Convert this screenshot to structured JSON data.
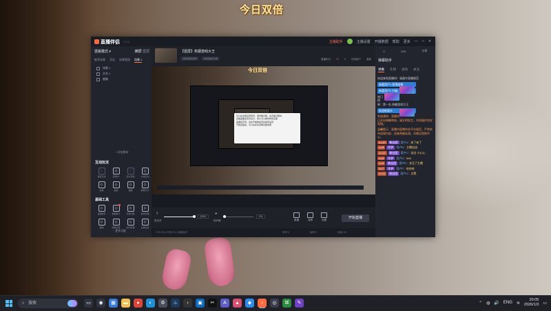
{
  "desktop": {
    "overlay_title": "今日双倍"
  },
  "app": {
    "name": "直播伴侣",
    "version": "7.0.0",
    "titlebar": {
      "items": [
        "主播设置",
        "开播数据",
        "帮助",
        "更多"
      ],
      "status": "主播助手"
    },
    "left": {
      "mode_label": "竖版模式",
      "mode_tabs": [
        "横屏",
        "竖屏"
      ],
      "source_tabs": [
        "推荐场景",
        "添加",
        "场景管理",
        "场景 1"
      ],
      "sources": [
        "场景 1",
        "文本 1",
        "摄像"
      ],
      "add_source_label": "+ 添加素材",
      "interact_title": "互动玩法",
      "interact_items": [
        {
          "label": "语音互动",
          "icon": "mic-icon",
          "dim": true
        },
        {
          "label": "连线PK",
          "icon": "pk-icon",
          "dim": false
        },
        {
          "label": "观众连线",
          "icon": "link-icon",
          "dim": true
        },
        {
          "label": "礼物互动",
          "icon": "gift-icon",
          "dim": false
        },
        {
          "label": "投票",
          "icon": "download-icon",
          "dim": false
        },
        {
          "label": "抽奖",
          "icon": "lottery-icon",
          "dim": false
        },
        {
          "label": "福袋",
          "icon": "bag-icon",
          "dim": false
        },
        {
          "label": "屏幕分享",
          "icon": "share-icon",
          "dim": false
        }
      ],
      "tools_title": "基础工具",
      "tools_items": [
        {
          "label": "直播助手",
          "icon": "assistant-icon",
          "badge": false
        },
        {
          "label": "数据统计",
          "icon": "chart-icon",
          "badge": true
        },
        {
          "label": "高级功能",
          "icon": "advanced-icon",
          "badge": false
        },
        {
          "label": "素材管理",
          "icon": "material-icon",
          "badge": false
        },
        {
          "label": "美颜",
          "icon": "beauty-icon",
          "badge": false
        },
        {
          "label": "弹幕设置",
          "icon": "danmaku-icon",
          "badge": false
        },
        {
          "label": "房间管理",
          "icon": "room-icon",
          "badge": false
        },
        {
          "label": "主播任务",
          "icon": "task-icon",
          "badge": false
        }
      ],
      "more_label": "··· 更多功能"
    },
    "room": {
      "title": "【竖屏】热梗游戏大王",
      "tags": [
        "当前直播间名称",
        "当前直播间分类"
      ],
      "stats": [
        "直播时长",
        "17",
        "0",
        "在线用户",
        "音频"
      ]
    },
    "preview": {
      "overlay_title": "今日双倍",
      "tooltip_lines": [
        "可以在这里设置场景、素材等内容，在直播过程中，",
        "直播画面会实时显示，观众可以看到你的直播",
        "画面和声音，请在开播前检查好各项设置",
        "开始直播后，可以在此处查看直播效果"
      ]
    },
    "controls": {
      "mic_label": "麦克风",
      "mic_percent": "100%",
      "mic_level": 1.0,
      "speaker_label": "扬声器",
      "speaker_percent": "0%",
      "speaker_level": 0.05,
      "buttons": [
        "直播",
        "录屏",
        "设置"
      ],
      "go_live_label": "开始直播"
    },
    "statusbar": {
      "left": "CPU 0%  |  内存 0%  |  网络良好",
      "items": [
        "码率 0",
        "帧率 0",
        "丢帧 0%"
      ]
    },
    "right": {
      "stats": [
        "0",
        "1/25",
        "分享"
      ],
      "head": "弹幕助手",
      "tabs": [
        "弹幕",
        "礼物",
        "进场",
        "关注"
      ],
      "chat": [
        {
          "type": "text",
          "text": "欢迎来到直播间！请遵守直播规范"
        },
        {
          "type": "banner",
          "text": "恭喜用户1 获得勋章"
        },
        {
          "type": "banner",
          "text": "恭喜用户2 升级"
        },
        {
          "type": "text",
          "text": "热门榜单：第一名 热梗游戏大王"
        },
        {
          "type": "banner",
          "text": "欢迎新观众"
        },
        {
          "type": "notice",
          "text": "系统通知：直播间已开启弹幕审核，请文明发言，共同维护良好氛围。"
        },
        {
          "type": "notice",
          "text": "温馨提示：直播内容需符合平台规范，严禁发布违规内容，违者将被处理。详情见帮助中心。"
        },
        {
          "type": "user",
          "level": "Lv.10",
          "badge": "粉丝团",
          "name": "用户A",
          "text": "来了来了"
        },
        {
          "type": "user",
          "level": "Lv.8",
          "badge": "守护",
          "name": "用户B",
          "text": "主播加油"
        },
        {
          "type": "user",
          "level": "Lv.12",
          "badge": "粉丝团",
          "name": "用户C",
          "text": "送出 小心心"
        },
        {
          "type": "user",
          "level": "Lv.5",
          "badge": "守护",
          "name": "用户D",
          "text": "666"
        },
        {
          "type": "user",
          "level": "Lv.9",
          "badge": "粉丝团",
          "name": "用户E",
          "text": "关注了主播"
        },
        {
          "type": "user",
          "level": "Lv.7",
          "badge": "守护",
          "name": "用户F",
          "text": "哈哈哈"
        },
        {
          "type": "user",
          "level": "Lv.11",
          "badge": "粉丝团",
          "name": "用户G",
          "text": "点赞"
        }
      ]
    }
  },
  "taskbar": {
    "search_placeholder": "搜索",
    "apps": [
      {
        "icon": "file-explorer-icon",
        "color": "#2f3340",
        "glyph": "▭",
        "active": false
      },
      {
        "icon": "camera-icon",
        "color": "#2f3340",
        "glyph": "◉",
        "active": false
      },
      {
        "icon": "widgets-icon",
        "color": "#3a7bd5",
        "glyph": "▦",
        "active": false
      },
      {
        "icon": "folder-icon",
        "color": "#f2c14e",
        "glyph": "▬",
        "active": false
      },
      {
        "icon": "chrome-icon",
        "color": "#db4437",
        "glyph": "●",
        "active": false
      },
      {
        "icon": "edge-icon",
        "color": "#1f8fd6",
        "glyph": "◐",
        "active": false
      },
      {
        "icon": "settings-icon",
        "color": "#4a4e5a",
        "glyph": "⚙",
        "active": false
      },
      {
        "icon": "steam-icon",
        "color": "#1b3a5c",
        "glyph": "♨",
        "active": false
      },
      {
        "icon": "terminal-icon",
        "color": "#333",
        "glyph": "›",
        "active": false
      },
      {
        "icon": "store-icon",
        "color": "#0f6cbd",
        "glyph": "▣",
        "active": false
      },
      {
        "icon": "capcut-icon",
        "color": "#111",
        "glyph": "✂",
        "active": false
      },
      {
        "icon": "ai-icon",
        "color": "#5b5fc7",
        "glyph": "A",
        "active": false
      },
      {
        "icon": "photo-icon",
        "color": "#d94f70",
        "glyph": "▲",
        "active": false
      },
      {
        "icon": "chat-app-icon",
        "color": "#2d8cf0",
        "glyph": "◆",
        "active": false
      },
      {
        "icon": "live-companion-icon",
        "color": "#ff6a3d",
        "glyph": "♪",
        "active": true
      },
      {
        "icon": "browser-icon",
        "color": "#3a3d49",
        "glyph": "◎",
        "active": false
      },
      {
        "icon": "code-icon",
        "color": "#2b8a3e",
        "glyph": "⌘",
        "active": false
      },
      {
        "icon": "note-icon",
        "color": "#6f42c1",
        "glyph": "✎",
        "active": false
      }
    ],
    "lang": "ENG",
    "time": "20:05",
    "date": "2026/1/3"
  }
}
